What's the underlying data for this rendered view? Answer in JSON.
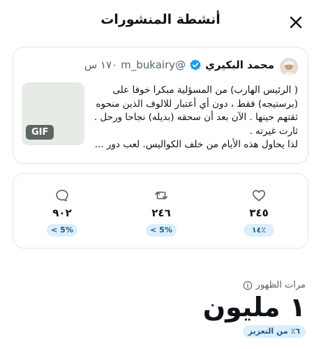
{
  "header": {
    "title": "أنشطة المنشورات",
    "close_icon": "close-icon"
  },
  "tweet": {
    "author_name": "محمد البكيري",
    "handle": "@m_bukairy",
    "time": "١٧٠ س",
    "verified_icon": "verified-badge-icon",
    "lines": [
      "( الرئيس الهارب) من المسؤلية مبكرا خوفا على",
      "(برستيجه) فقط ، دون أي أعتبار للالوف الذين منحوه",
      "ثقتهم  حينها . الآن بعد أن سحقه (بديله) نجاحا ورحل .",
      "ثارت غيرته .",
      "لذا يحاول هذه الأيام من خلف الكواليس. لعب دور ..."
    ],
    "media_badge": "GIF"
  },
  "stats": {
    "replies": {
      "icon": "reply-icon",
      "value": "٩٠٢",
      "change": "< 5%"
    },
    "reposts": {
      "icon": "repost-icon",
      "value": "٢٤٦",
      "change": "< 5%"
    },
    "likes": {
      "icon": "heart-icon",
      "value": "٣٤٥",
      "change": "١٤٪"
    }
  },
  "impressions": {
    "label": "مرات الظهور",
    "info_icon": "info-icon",
    "value": "١ مليون",
    "boost": "٦٪ من التعزيز"
  },
  "colors": {
    "text": "#0f1419",
    "muted": "#536471",
    "border": "#e1e6ea",
    "badge_bg": "#dbeefa",
    "badge_text": "#1a5a89",
    "verified": "#1d9bf0"
  }
}
